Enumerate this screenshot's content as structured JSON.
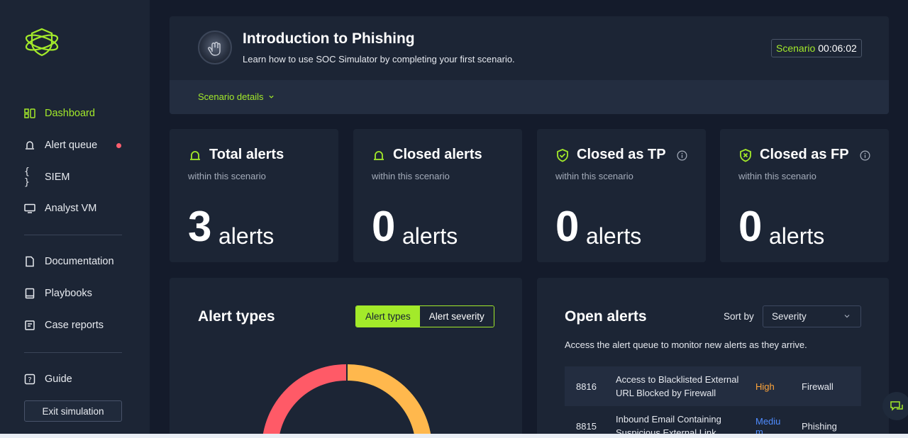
{
  "sidebar": {
    "items": [
      {
        "label": "Dashboard",
        "icon": "dashboard-icon",
        "active": true
      },
      {
        "label": "Alert queue",
        "icon": "alert-queue-icon",
        "notification_dot": true
      },
      {
        "label": "SIEM",
        "icon": "braces-icon"
      },
      {
        "label": "Analyst VM",
        "icon": "monitor-icon"
      },
      {
        "label": "Documentation",
        "icon": "document-icon"
      },
      {
        "label": "Playbooks",
        "icon": "book-icon"
      },
      {
        "label": "Case reports",
        "icon": "report-icon"
      },
      {
        "label": "Guide",
        "icon": "question-icon"
      }
    ],
    "exit_label": "Exit simulation"
  },
  "header": {
    "title": "Introduction to Phishing",
    "subtitle": "Learn how to use SOC Simulator by completing your first scenario.",
    "timer_label": "Scenario",
    "timer_value": "00:06:02",
    "details_link": "Scenario details"
  },
  "stats": [
    {
      "title": "Total alerts",
      "subtitle": "within this scenario",
      "value": "3",
      "unit": "alerts",
      "icon": "alert-siren-icon"
    },
    {
      "title": "Closed alerts",
      "subtitle": "within this scenario",
      "value": "0",
      "unit": "alerts",
      "icon": "alert-siren-icon"
    },
    {
      "title": "Closed as TP",
      "subtitle": "within this scenario",
      "value": "0",
      "unit": "alerts",
      "icon": "shield-check-icon"
    },
    {
      "title": "Closed as FP",
      "subtitle": "within this scenario",
      "value": "0",
      "unit": "alerts",
      "icon": "shield-x-icon"
    }
  ],
  "alert_types": {
    "title": "Alert types",
    "toggle": [
      "Alert types",
      "Alert severity"
    ],
    "active_toggle": "Alert types",
    "donut_colors": [
      "#ff5a67",
      "#ffb84d"
    ]
  },
  "open_alerts": {
    "title": "Open alerts",
    "sort_label": "Sort by",
    "sort_value": "Severity",
    "description": "Access the alert queue to monitor new alerts as they arrive.",
    "rows": [
      {
        "id": "8816",
        "name": "Access to Blacklisted External URL Blocked by Firewall",
        "severity": "High",
        "severity_color": "#ffa53a",
        "category": "Firewall"
      },
      {
        "id": "8815",
        "name": "Inbound Email Containing Suspicious External Link",
        "severity": "Medium",
        "severity_color": "#4f8cff",
        "category": "Phishing"
      }
    ]
  },
  "colors": {
    "accent": "#a3ea2a",
    "background": "#141b2b",
    "card": "#1c2535"
  }
}
